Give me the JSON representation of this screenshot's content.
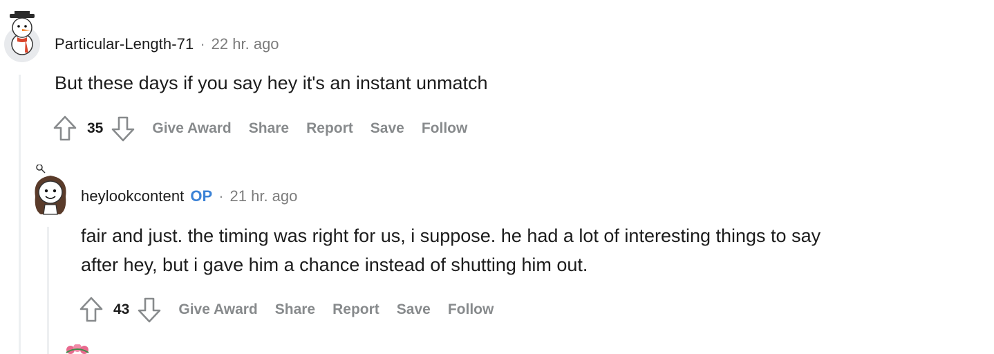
{
  "comments": [
    {
      "author": "Particular-Length-71",
      "separator": "·",
      "time": "22 hr. ago",
      "body_lines": [
        "But these days if you say hey it's an instant unmatch"
      ],
      "score": "35",
      "actions": [
        "Give Award",
        "Share",
        "Report",
        "Save",
        "Follow"
      ]
    },
    {
      "author": "heylookcontent",
      "op_badge": "OP",
      "separator": "·",
      "time": "21 hr. ago",
      "body_lines": [
        "fair and just. the timing was right for us, i suppose. he had a lot of interesting things to say",
        "after hey, but i gave him a chance instead of shutting him out."
      ],
      "score": "43",
      "actions": [
        "Give Award",
        "Share",
        "Report",
        "Save",
        "Follow"
      ]
    }
  ],
  "colors": {
    "op": "#3b82d6",
    "action_text": "#878a8c",
    "thread_line": "#edeff1"
  },
  "icons": [
    "snowman-avatar-icon",
    "girl-avatar-icon",
    "flower-avatar-icon",
    "upvote-arrow-icon",
    "downvote-arrow-icon"
  ]
}
